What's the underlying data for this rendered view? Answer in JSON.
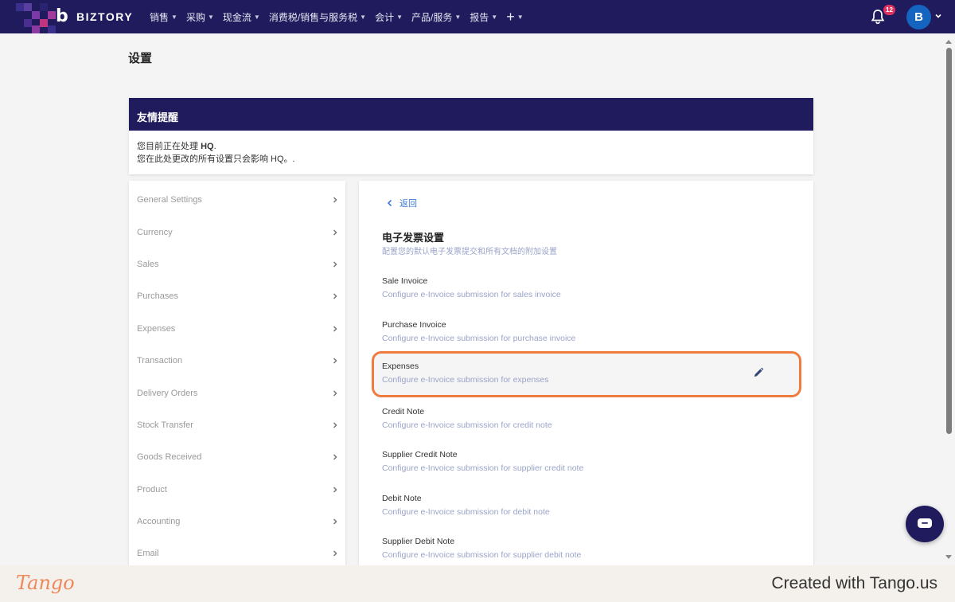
{
  "topnav": {
    "brand": "BIZTORY",
    "menu": [
      "销售",
      "采购",
      "现金流",
      "消费税/销售与服务税",
      "会计",
      "产品/服务",
      "报告"
    ],
    "notification_count": "12",
    "avatar_initial": "B",
    "bg_color": "#1f1b5c"
  },
  "page": {
    "title": "设置"
  },
  "reminder": {
    "heading": "友情提醒",
    "line1_prefix": "您目前正在处理 ",
    "line1_entity": "HQ",
    "line1_suffix": ".",
    "line2": "您在此处更改的所有设置只会影响 HQ。."
  },
  "settings_menu": [
    "General Settings",
    "Currency",
    "Sales",
    "Purchases",
    "Expenses",
    "Transaction",
    "Delivery Orders",
    "Stock Transfer",
    "Goods Received",
    "Product",
    "Accounting",
    "Email"
  ],
  "panel": {
    "back_label": "返回",
    "title": "电子发票设置",
    "subtitle": "配置您的默认电子发票提交和所有文档的附加设置",
    "rows": [
      {
        "title": "Sale Invoice",
        "desc": "Configure e-Invoice submission for sales invoice"
      },
      {
        "title": "Purchase Invoice",
        "desc": "Configure e-Invoice submission for purchase invoice"
      },
      {
        "title": "Expenses",
        "desc": "Configure e-Invoice submission for expenses"
      },
      {
        "title": "Credit Note",
        "desc": "Configure e-Invoice submission for credit note"
      },
      {
        "title": "Supplier Credit Note",
        "desc": "Configure e-Invoice submission for supplier credit note"
      },
      {
        "title": "Debit Note",
        "desc": "Configure e-Invoice submission for debit note"
      },
      {
        "title": "Supplier Debit Note",
        "desc": "Configure e-Invoice submission for supplier debit note"
      }
    ],
    "highlight_color": "#f07b3f"
  },
  "footer": {
    "logo": "Tango",
    "credit": "Created with Tango.us"
  }
}
